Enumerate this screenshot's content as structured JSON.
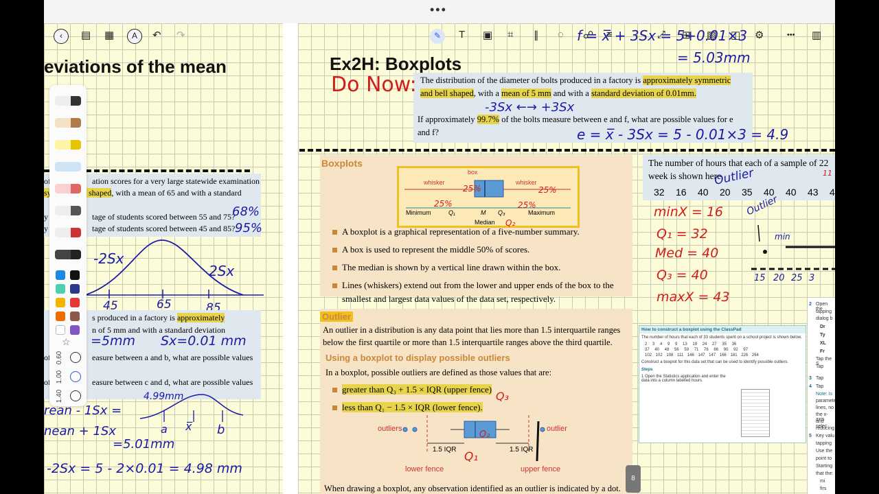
{
  "topbar": {
    "more": "•••"
  },
  "toolbar_left": {
    "back": "‹",
    "sidebar": "▤",
    "grid": "▦",
    "pen_mode": "A",
    "undo": "↶",
    "redo": "↷"
  },
  "toolbar_right": {
    "pen": "✎",
    "text": "T",
    "image": "▣",
    "crop": "⌗",
    "ruler": "∥",
    "comment": "◌",
    "link": "☍",
    "layers": "≡",
    "expand": "⤢",
    "add": "⊞",
    "eraser": "▧",
    "split": "◫",
    "settings": "⚙",
    "more": "•••",
    "panel": "▥"
  },
  "palette": {
    "sizes": [
      "0.60",
      "1.00",
      "1.40"
    ],
    "colors": [
      "#1e88e5",
      "#111111",
      "#4dd0b0",
      "#2a3a8a",
      "#f2b400",
      "#e53935",
      "#ef6c00",
      "#8d5a4a",
      "#ffffff",
      "#7e57c2"
    ]
  },
  "left_page": {
    "title": "eviations of the mean",
    "q1_line1": "of",
    "q1_line1b": "ation scores for a very large statewide examination",
    "q1_line2a": "sy",
    "q1_line2b": "d bell shaped",
    "q1_line2c": ", with a mean of 65 and with a standard",
    "q1_a": "tage of students scored between 55 and 75?",
    "q1_b": "tage of students scored between 45 and 85?",
    "q1_prefix_a": "y",
    "q1_prefix_b": "y",
    "q2_line1": "s produced in a factory is ",
    "q2_hl": "approximately",
    "q2_line2": "n of 5 mm and with a standard deviation",
    "q2_line3": "easure between a and b, what are possible values",
    "q2_line4": "easure between c and d, what are possible values",
    "q2_prefix_c": "of",
    "q2_prefix_d": "of",
    "ink": {
      "ans1": "68%",
      "ans2": "95%",
      "m2sx": "-2Sx",
      "p2sx": "2Sx",
      "t45": "45",
      "t65": "65",
      "t85": "85",
      "mean5": "=5mm",
      "sx": "Sx=0.01 mm",
      "v499": "4.99mm",
      "ea": "a",
      "eb": "b",
      "ebar": "x̅",
      "l1": "rean - 1Sx =",
      "l2": "nean + 1Sx",
      "l3": "=5.01mm",
      "l4": "-2Sx = 5 - 2×0.01 = 4.98 mm"
    }
  },
  "right_page": {
    "title": "Ex2H: Boxplots",
    "donow": {
      "p1a": "The distribution of the diameter of bolts produced in a factory is ",
      "p1hl1": "approximately symmetric and bell shaped",
      "p1b": ", with a ",
      "p1hl2": "mean of 5 mm",
      "p1c": " and with a ",
      "p1hl3": "standard deviation of 0.01mm.",
      "p2a": "If approximately ",
      "p2hl": "99.7%",
      "p2b": " of the bolts measure between e and f, what are possible values for e and f?"
    },
    "ink": {
      "donow": "Do Now:",
      "top_formula": "f = x̅ + 3Sx = 5+0.01×3",
      "top_result": "= 5.03mm",
      "range": "-3Sx ←→ +3Sx",
      "e_formula": "e = x̅ - 3Sx = 5 - 0.01×3 = 4.9",
      "outlier": "Outlier",
      "minx": "minX = 16",
      "q1": "Q₁ = 32",
      "med": "Med = 40",
      "q3": "Q₃ = 40",
      "maxx": "maxX = 43",
      "p25a": "25%",
      "p25b": "25%",
      "p25c": "25%",
      "p25d": "25%",
      "ink_min": "min",
      "ink_11": "11",
      "q1lbl": "Q₁",
      "q2lbl": "Q₂",
      "q3lbl": "Q₃",
      "q2b": "Q₂",
      "outlier2": "Outlier",
      "axis15": "15",
      "axis20": "20",
      "axis25": "25",
      "axis3": "3"
    },
    "boxplots": {
      "heading": "Boxplots",
      "box_label": "box",
      "whisker_left": "whisker",
      "whisker_right": "whisker",
      "minimum": "Minimum",
      "q1": "Q₁",
      "m": "M",
      "q3": "Q₃",
      "maximum": "Maximum",
      "median": "Median",
      "bullets": [
        "A boxplot is a graphical representation of a five-number summary.",
        "A box is used to represent the middle 50% of scores.",
        "The median is shown by a vertical line drawn within the box.",
        "Lines (whiskers) extend out from the lower and upper ends of the box to the smallest and largest data values of the data set, respectively."
      ]
    },
    "hours_box": {
      "text1": "The number of hours that each of a sample of 22",
      "text2": "week is shown here.",
      "values": [
        "32",
        "16",
        "40",
        "20",
        "35",
        "40",
        "40",
        "43",
        "4"
      ]
    },
    "outlier": {
      "heading": "Outlier",
      "text": "An outlier in a distribution is any data point that lies more than 1.5 interquartile ranges below the first quartile or more than 1.5 interquartile ranges above the third quartile.",
      "subheading": "Using a boxplot to display possible outliers",
      "intro": "In a boxplot, possible outliers are defined as those values that are:",
      "b1": "greater than Q₃ + 1.5 × IQR (upper fence)",
      "b2": "less than Q₁ − 1.5 × IQR (lower fence).",
      "outliers_left": "outliers",
      "outlier_right": "outlier",
      "iqr_left": "1.5 IQR",
      "iqr_right": "1.5 IQR",
      "lower_fence": "lower fence",
      "upper_fence": "upper fence",
      "footer": "When drawing a boxplot, any observation identified as an outlier is indicated by a dot."
    },
    "classpad": {
      "title": "How to construct a boxplot using the ClassPad",
      "intro": "The number of hours that each of 33 students spent on a school project is shown below.",
      "row1": "2  3  4  9  9  13  19  24  27  35  36",
      "row2": "37  40  48  56  59  71  76  86  90  92  97",
      "row3": "102  102  108  111  146  147  147  166  181  226  264",
      "task": "Construct a boxplot for this data set that can be used to identify possible outliers.",
      "steps": "Steps",
      "step1": "1  Open the Statistics application and enter the data into a column labelled hours."
    },
    "sidebar_steps": {
      "s2": "2",
      "s2t": "Open the",
      "s2b": "tapping",
      "s2c": "dialog b",
      "d1": "Dr",
      "d2": "Ty",
      "d3": "XL",
      "d4": "Fr",
      "tap1": "Tap the S",
      "tap2": "Tap",
      "s3": "3",
      "s3t": "Tap",
      "s4": "4",
      "s4t": "Tap",
      "note": "Note: Is",
      "n1": "paramete",
      "n2": "lines, no",
      "n3": "the x-axis",
      "n4": "and selec",
      "n5": "reducing",
      "s5": "5",
      "s5t": "Key valu",
      "s5b": "tapping",
      "s5c": "Use the",
      "s5d": "point to",
      "s5e": "Starting",
      "s5f": "that the:",
      "s5g": "mi",
      "s5h": "firs"
    },
    "page_number": "8"
  }
}
